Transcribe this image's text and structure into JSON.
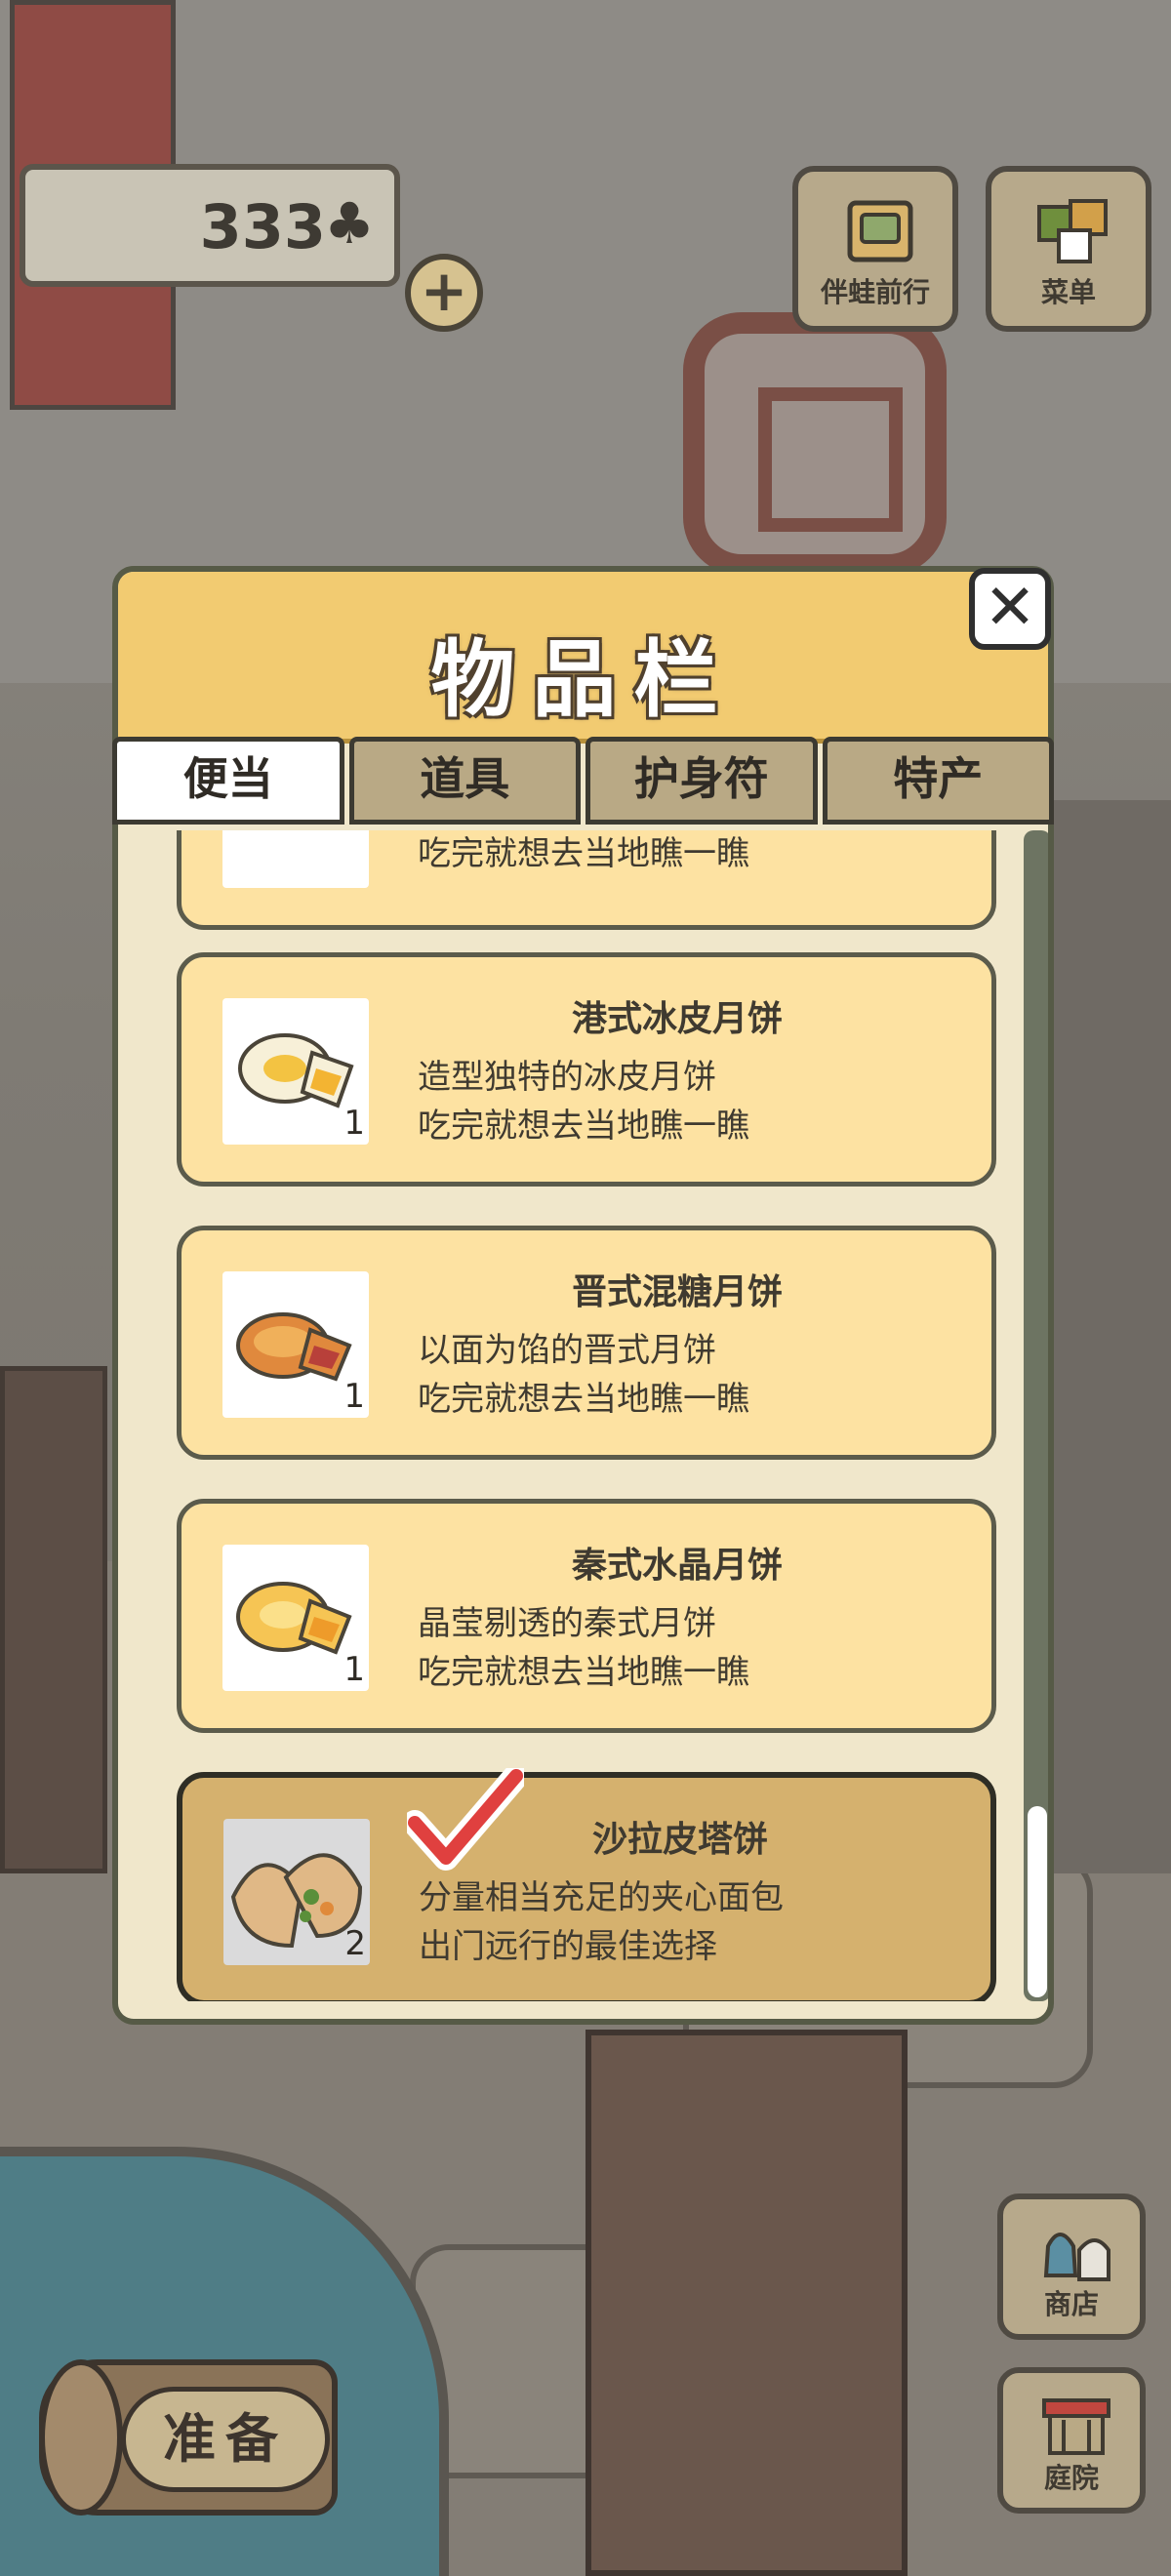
{
  "hud": {
    "clover_count": "333",
    "clover_icon": "clover-icon",
    "add_symbol": "+",
    "travel_label": "伴蛙前行",
    "menu_label": "菜单",
    "shop_label": "商店",
    "yard_label": "庭院",
    "ready_label": "准备"
  },
  "inventory": {
    "title": "物品栏",
    "close_symbol": "✕",
    "tabs": [
      {
        "label": "便当",
        "active": true
      },
      {
        "label": "道具",
        "active": false
      },
      {
        "label": "护身符",
        "active": false
      },
      {
        "label": "特产",
        "active": false
      }
    ],
    "items": [
      {
        "name": "",
        "desc1": "",
        "desc2": "吃完就想去当地瞧一瞧",
        "qty": "",
        "selected": false
      },
      {
        "name": "港式冰皮月饼",
        "desc1": "造型独特的冰皮月饼",
        "desc2": "吃完就想去当地瞧一瞧",
        "qty": "1",
        "selected": false
      },
      {
        "name": "晋式混糖月饼",
        "desc1": "以面为馅的晋式月饼",
        "desc2": "吃完就想去当地瞧一瞧",
        "qty": "1",
        "selected": false
      },
      {
        "name": "秦式水晶月饼",
        "desc1": "晶莹剔透的秦式月饼",
        "desc2": "吃完就想去当地瞧一瞧",
        "qty": "1",
        "selected": false
      },
      {
        "name": "沙拉皮塔饼",
        "desc1": "分量相当充足的夹心面包",
        "desc2": "出门远行的最佳选择",
        "qty": "2",
        "selected": true
      }
    ]
  },
  "colors": {
    "panel_header": "#f2cb71",
    "item_bg": "#fde2a2",
    "item_selected_bg": "#d5b16e",
    "check_red": "#e0403f"
  }
}
